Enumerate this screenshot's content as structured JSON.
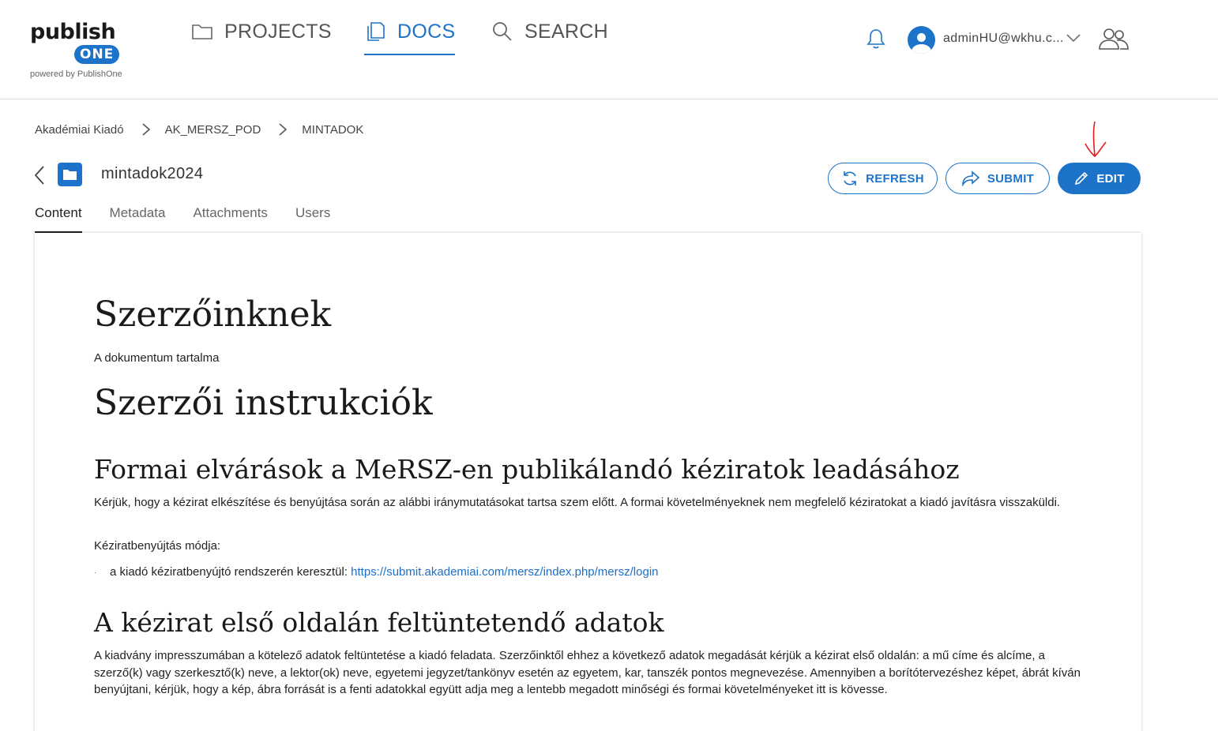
{
  "brand": {
    "logo_main": "publish",
    "logo_badge": "ONE",
    "powered_by": "powered by PublishOne",
    "accent": "#1d73c9"
  },
  "nav": {
    "projects": "PROJECTS",
    "docs": "DOCS",
    "search": "SEARCH"
  },
  "user": {
    "name": "adminHU@wkhu.c..."
  },
  "breadcrumb": [
    "Akadémiai Kiadó",
    "AK_MERSZ_POD",
    "MINTADOK"
  ],
  "document": {
    "title": "mintadok2024"
  },
  "actions": {
    "refresh": "REFRESH",
    "submit": "SUBMIT",
    "edit": "EDIT"
  },
  "tabs": [
    "Content",
    "Metadata",
    "Attachments",
    "Users"
  ],
  "content": {
    "heading1": "Szerzőinknek",
    "subtitle": "A dokumentum tartalma",
    "heading2": "Szerzői instrukciók",
    "section1_title": "Formai elvárások a MeRSZ-en publikálandó kéziratok leadásához",
    "section1_p1": "Kérjük, hogy a kézirat elkészítése és benyújtása során az alábbi iránymutatásokat tartsa szem előtt. A formai követelményeknek nem megfelelő kéziratokat a kiadó javításra visszaküldi.",
    "section1_p2": "Kéziratbenyújtás módja:",
    "bullet_text": "a kiadó kéziratbenyújtó rendszerén keresztül:",
    "bullet_link": "https://submit.akademiai.com/mersz/index.php/mersz/login",
    "section2_title": "A kézirat első oldalán feltüntetendő adatok",
    "section2_p1": "A kiadvány impresszumában a kötelező adatok feltüntetése a kiadó feladata. Szerzőinktől ehhez a következő adatok megadását kérjük a kézirat első oldalán: a mű címe és alcíme, a szerző(k) vagy szerkesztő(k) neve, a lektor(ok) neve, egyetemi jegyzet/tankönyv esetén az egyetem, kar, tanszék pontos megnevezése. Amennyiben a borítótervezéshez képet, ábrát kíván benyújtani, kérjük, hogy a kép, ábra forrását is a fenti adatokkal együtt adja meg a lentebb megadott minőségi és formai követelményeket itt is kövesse."
  }
}
